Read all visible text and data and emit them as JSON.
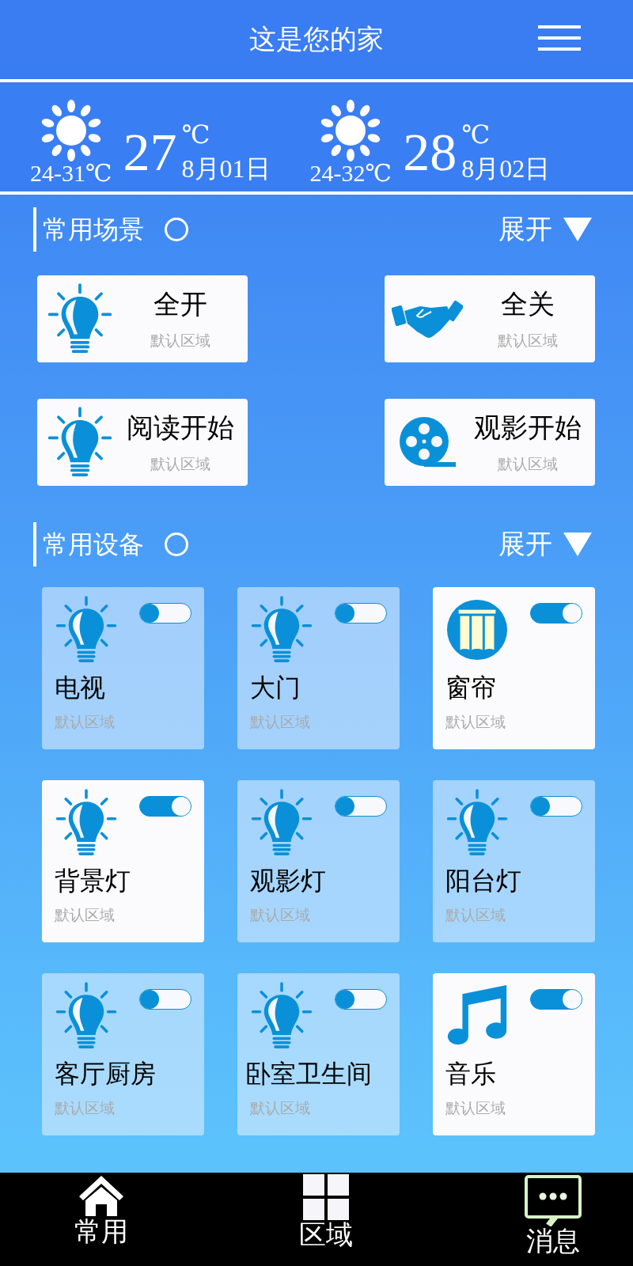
{
  "header": {
    "title": "这是您的家"
  },
  "weather": [
    {
      "range": "24-31℃",
      "temp": "27",
      "unit": "℃",
      "date": "8月01日"
    },
    {
      "range": "24-32℃",
      "temp": "28",
      "unit": "℃",
      "date": "8月02日"
    }
  ],
  "scenes_section": {
    "title": "常用场景",
    "expand": "展开"
  },
  "scenes": [
    {
      "kind": "bulb",
      "name": "全开",
      "area": "默认区域"
    },
    {
      "kind": "handshake",
      "name": "全关",
      "area": "默认区域"
    },
    {
      "kind": "bulb",
      "name": "阅读开始",
      "area": "默认区域"
    },
    {
      "kind": "film",
      "name": "观影开始",
      "area": "默认区域"
    }
  ],
  "devices_section": {
    "title": "常用设备",
    "expand": "展开"
  },
  "devices": [
    {
      "kind": "bulb",
      "name": "电视",
      "area": "默认区域",
      "on": false
    },
    {
      "kind": "bulb",
      "name": "大门",
      "area": "默认区域",
      "on": false
    },
    {
      "kind": "curtain",
      "name": "窗帘",
      "area": "默认区域",
      "on": true
    },
    {
      "kind": "bulb",
      "name": "背景灯",
      "area": "默认区域",
      "on": true
    },
    {
      "kind": "bulb",
      "name": "观影灯",
      "area": "默认区域",
      "on": false
    },
    {
      "kind": "bulb",
      "name": "阳台灯",
      "area": "默认区域",
      "on": false
    },
    {
      "kind": "bulb",
      "name": "客厅厨房",
      "area": "默认区域",
      "on": false
    },
    {
      "kind": "bulb",
      "name": "卧室卫生间",
      "area": "默认区域",
      "on": false
    },
    {
      "kind": "music",
      "name": "音乐",
      "area": "默认区域",
      "on": true
    }
  ],
  "tabs": [
    {
      "kind": "home",
      "label": "常用"
    },
    {
      "kind": "grid",
      "label": "区域"
    },
    {
      "kind": "chat",
      "label": "消息"
    }
  ]
}
